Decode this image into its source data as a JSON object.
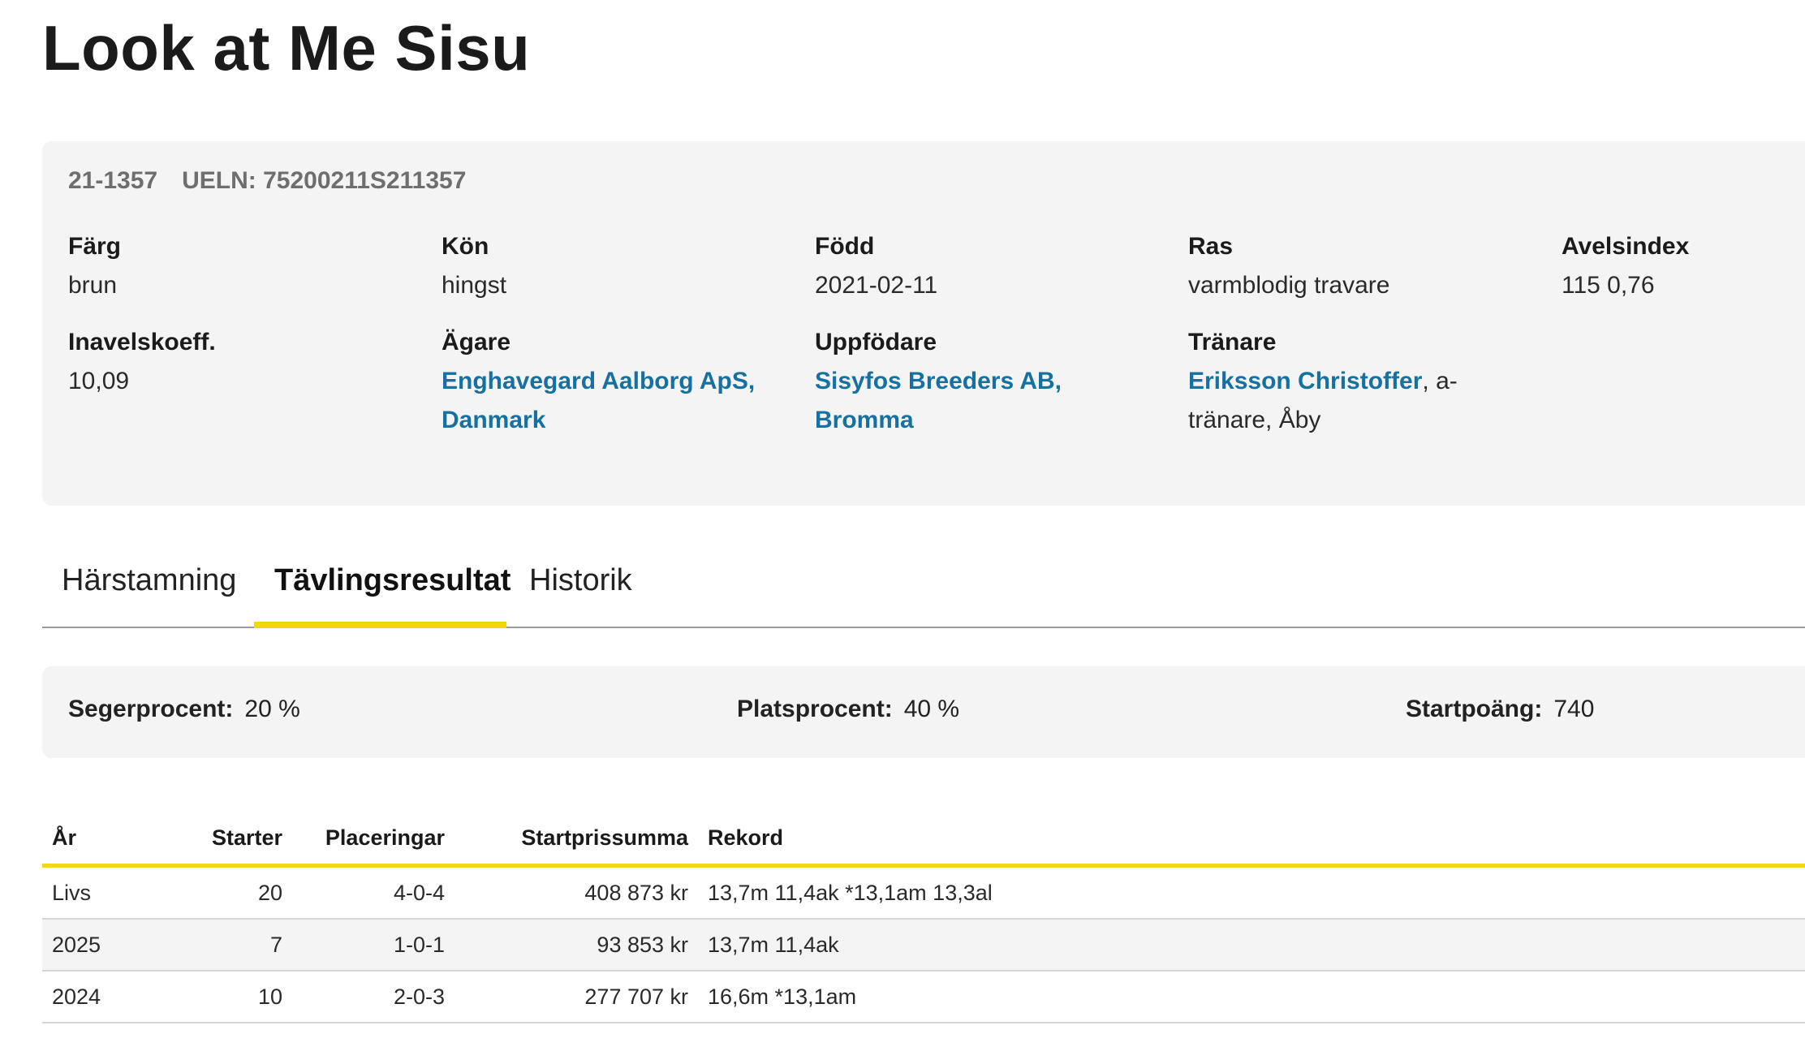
{
  "horse": {
    "name": "Look at Me Sisu",
    "reg_no": "21-1357",
    "ueln": "UELN: 75200211S211357"
  },
  "details": {
    "color": {
      "label": "Färg",
      "value": "brun"
    },
    "sex": {
      "label": "Kön",
      "value": "hingst"
    },
    "born": {
      "label": "Född",
      "value": "2021-02-11"
    },
    "breed": {
      "label": "Ras",
      "value": "varmblodig travare"
    },
    "breeding_index": {
      "label": "Avelsindex",
      "value": "115 0,76"
    },
    "inbreeding": {
      "label": "Inavelskoeff.",
      "value": "10,09"
    },
    "owner": {
      "label": "Ägare",
      "line1": "Enghavegard Aalborg ApS,",
      "line2": "Danmark"
    },
    "breeder": {
      "label": "Uppfödare",
      "line1": "Sisyfos Breeders AB,",
      "line2": "Bromma"
    },
    "trainer": {
      "label": "Tränare",
      "name": "Eriksson Christoffer",
      "suffix1": ", a-",
      "line2": "tränare, Åby"
    }
  },
  "tabs": [
    {
      "label": "Härstamning",
      "active": false
    },
    {
      "label": "Tävlingsresultat",
      "active": true
    },
    {
      "label": "Historik",
      "active": false
    }
  ],
  "stats": {
    "win_pct": {
      "label": "Segerprocent:",
      "value": "20 %"
    },
    "place_pct": {
      "label": "Platsprocent:",
      "value": "40 %"
    },
    "start_points": {
      "label": "Startpoäng:",
      "value": "740"
    }
  },
  "results": {
    "headers": [
      "År",
      "Starter",
      "Placeringar",
      "Startprissumma",
      "Rekord"
    ],
    "rows": [
      {
        "year": "Livs",
        "starts": "20",
        "placings": "4-0-4",
        "prize": "408 873 kr",
        "record": "13,7m 11,4ak *13,1am 13,3al"
      },
      {
        "year": "2025",
        "starts": "7",
        "placings": "1-0-1",
        "prize": "93 853 kr",
        "record": "13,7m 11,4ak"
      },
      {
        "year": "2024",
        "starts": "10",
        "placings": "2-0-3",
        "prize": "277 707 kr",
        "record": "16,6m *13,1am"
      }
    ]
  },
  "colors": {
    "accent": "#f2d515",
    "link": "#1670a0",
    "card_bg": "#f4f4f4"
  }
}
